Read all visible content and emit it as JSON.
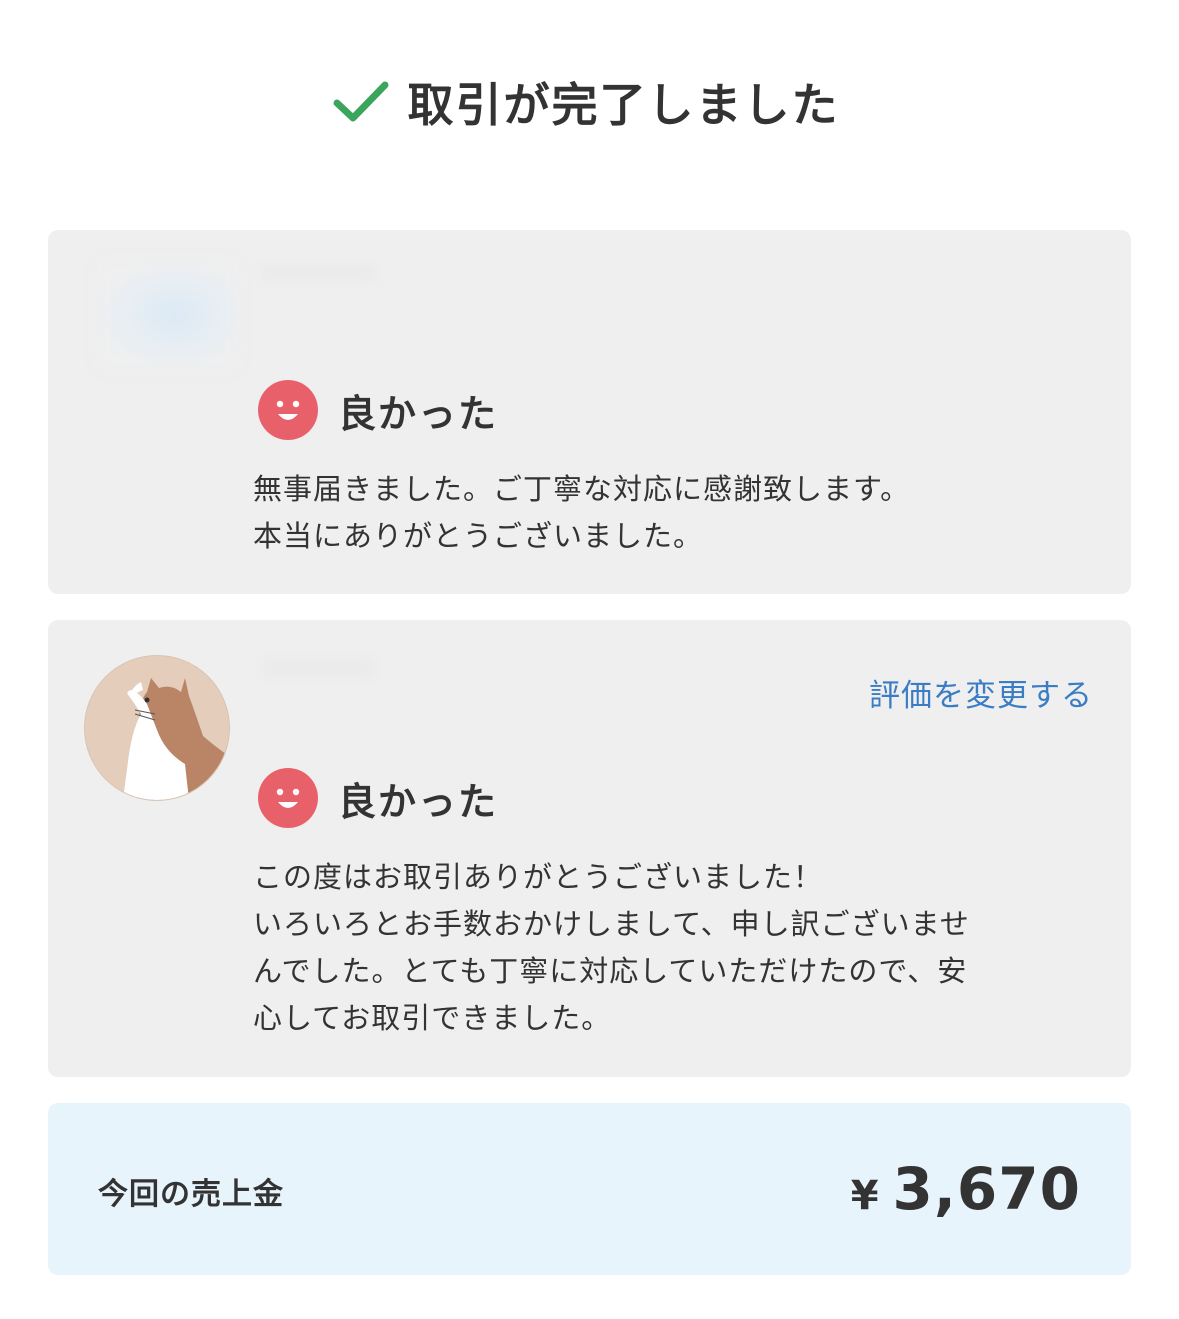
{
  "header": {
    "icon": "check-icon",
    "title": "取引が完了しました",
    "check_color": "#3ba55c"
  },
  "reviews": [
    {
      "rating_icon": "smile-icon",
      "rating_label": "良かった",
      "comment_lines": [
        "無事届きました。ご丁寧な対応に感謝致します。",
        "本当にありがとうございました。"
      ]
    },
    {
      "avatar": "cat-avatar",
      "change_link": "評価を変更する",
      "rating_icon": "smile-icon",
      "rating_label": "良かった",
      "comment_lines": [
        "この度はお取引ありがとうございました！",
        "いろいろとお手数おかけしまして、申し訳ございませ",
        "んでした。とても丁寧に対応していただけたので、安",
        "心してお取引できました。"
      ]
    }
  ],
  "sales": {
    "label": "今回の売上金",
    "currency": "¥",
    "amount": "3,670"
  },
  "colors": {
    "card_bg": "#efefef",
    "sales_bg": "#e8f4fc",
    "link": "#3b7dc4",
    "smile": "#e8616a"
  }
}
